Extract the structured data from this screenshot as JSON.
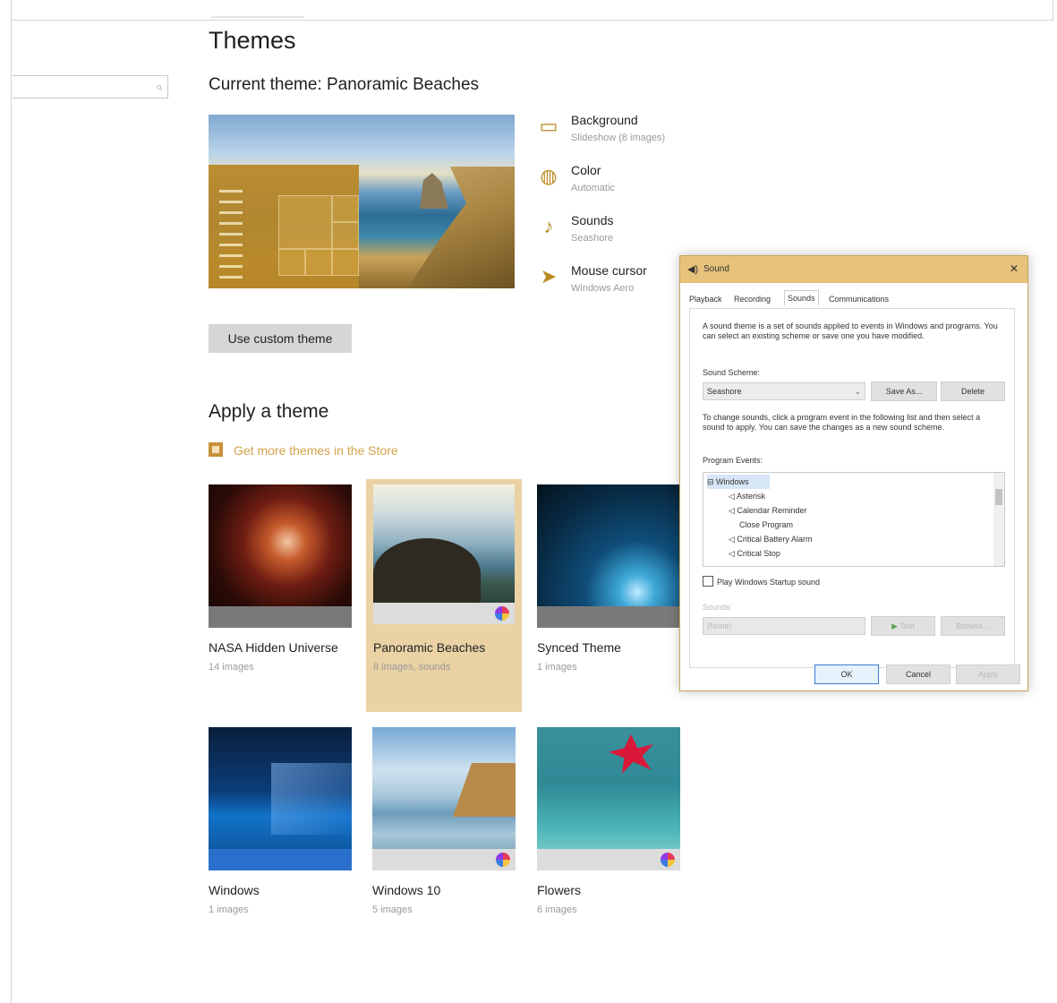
{
  "page": {
    "title": "Themes",
    "current_theme": "Current theme: Panoramic Beaches"
  },
  "search": {
    "placeholder": ""
  },
  "current_settings": [
    {
      "label": "Background",
      "value": "Slideshow (8 images)",
      "icon": "picture-icon"
    },
    {
      "label": "Color",
      "value": "Automatic",
      "icon": "palette-icon"
    },
    {
      "label": "Sounds",
      "value": "Seashore",
      "icon": "speaker-icon"
    },
    {
      "label": "Mouse cursor",
      "value": "Windows Aero",
      "icon": "cursor-icon"
    }
  ],
  "custom_theme_button": "Use custom theme",
  "apply": {
    "heading": "Apply a theme",
    "store_link": "Get more themes in the Store",
    "themes": [
      {
        "name": "NASA Hidden Universe",
        "count": "14 images",
        "selected": false
      },
      {
        "name": "Panoramic Beaches",
        "count": "8 images, sounds",
        "selected": true
      },
      {
        "name": "Synced Theme",
        "count": "1 images",
        "selected": false
      },
      {
        "name": "Windows",
        "count": "1 images",
        "selected": false
      },
      {
        "name": "Windows 10",
        "count": "5 images",
        "selected": false
      },
      {
        "name": "Flowers",
        "count": "6 images",
        "selected": false
      }
    ]
  },
  "sound_dialog": {
    "title": "Sound",
    "close": "✕",
    "tabs": [
      "Playback",
      "Recording",
      "Sounds",
      "Communications"
    ],
    "active_tab": "Sounds",
    "description": "A sound theme is a set of sounds applied to events in Windows and programs. You can select an existing scheme or save one you have modified.",
    "scheme_label": "Sound Scheme:",
    "scheme_value": "Seashore",
    "save_as": "Save As...",
    "delete": "Delete",
    "change_help": "To change sounds, click a program event in the following list and then select a sound to apply. You can save the changes as a new sound scheme.",
    "events_label": "Program Events:",
    "events": [
      "Windows",
      "Asterisk",
      "Calendar Reminder",
      "Close Program",
      "Critical Battery Alarm",
      "Critical Stop"
    ],
    "startup_checkbox": "Play Windows Startup sound",
    "sounds_label": "Sounds:",
    "sounds_value": "(None)",
    "test": "Test",
    "browse": "Browse...",
    "ok": "OK",
    "cancel": "Cancel",
    "apply": "Apply"
  },
  "colors": {
    "accent": "#c8913a",
    "selected_bg": "#ead2a5"
  }
}
